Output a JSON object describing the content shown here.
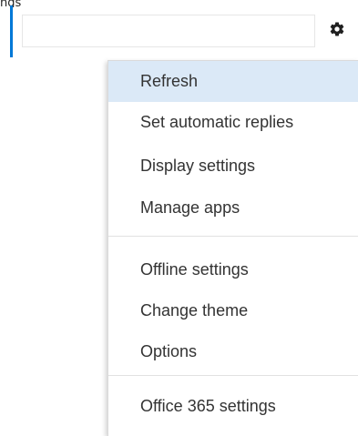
{
  "top_fragment": "ngs",
  "settings_icon": "gear-icon",
  "menu": {
    "items": [
      {
        "label": "Refresh",
        "highlighted": true
      },
      {
        "label": "Set automatic replies"
      },
      {
        "label": "Display settings"
      },
      {
        "label": "Manage apps"
      },
      {
        "label": "Offline settings"
      },
      {
        "label": "Change theme"
      },
      {
        "label": "Options"
      },
      {
        "label": "Office 365 settings"
      }
    ]
  },
  "colors": {
    "accent": "#0078d7",
    "highlight": "#dbe9f7",
    "text": "#333333"
  }
}
